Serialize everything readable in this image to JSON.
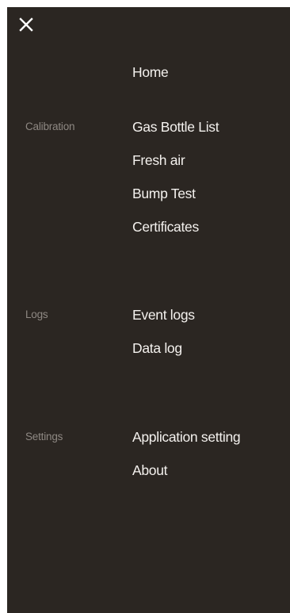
{
  "menu": {
    "close_icon": "close-icon",
    "home": "Home",
    "sections": [
      {
        "label": "Calibration",
        "items": [
          "Gas Bottle List",
          "Fresh air",
          "Bump Test",
          "Certificates"
        ]
      },
      {
        "label": "Logs",
        "items": [
          "Event logs",
          "Data log"
        ]
      },
      {
        "label": "Settings",
        "items": [
          "Application setting",
          "About"
        ]
      }
    ]
  },
  "colors": {
    "drawer_background": "#2b2622",
    "item_text": "#f4f1ee",
    "section_label_text": "#8e8883"
  }
}
